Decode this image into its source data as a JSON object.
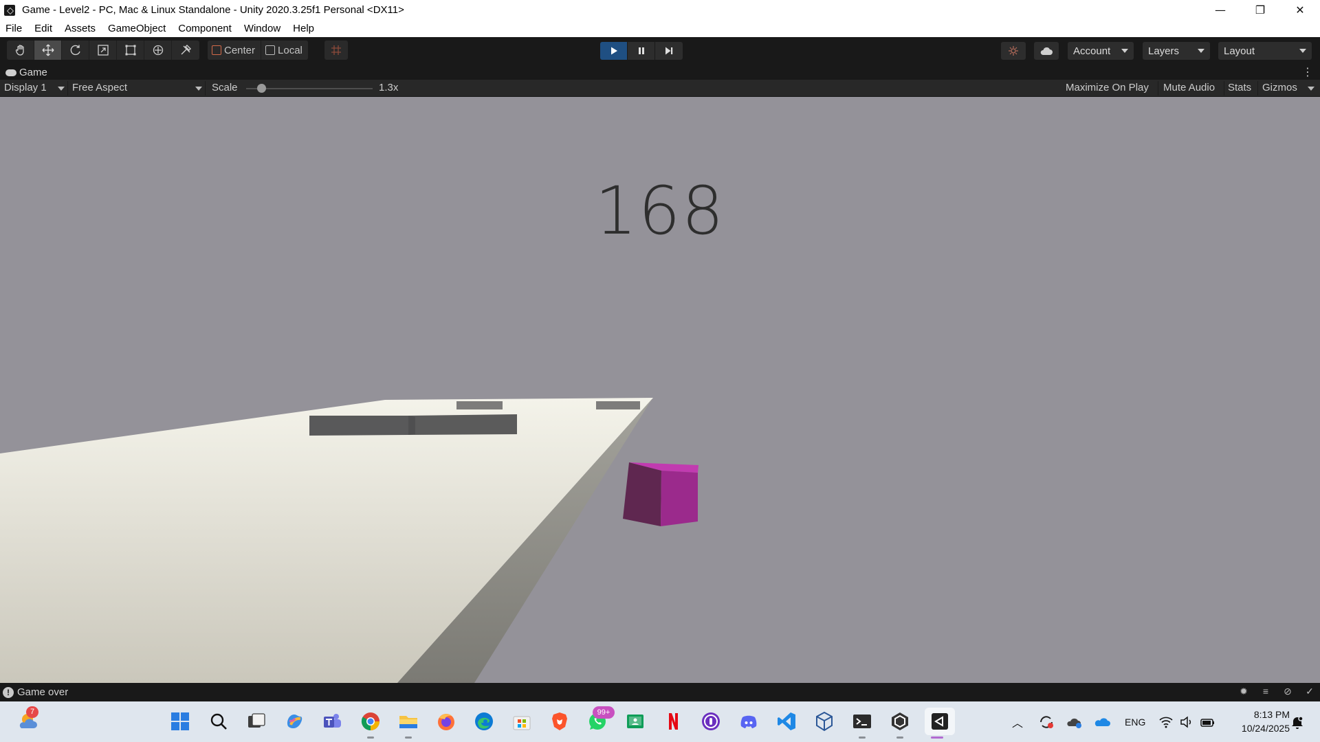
{
  "window": {
    "title": "Game - Level2 - PC, Mac & Linux Standalone - Unity 2020.3.25f1 Personal <DX11>",
    "controls": [
      "—",
      "❐",
      "✕"
    ]
  },
  "menu": [
    "File",
    "Edit",
    "Assets",
    "GameObject",
    "Component",
    "Window",
    "Help"
  ],
  "toolbar": {
    "tools": [
      "hand-tool-icon",
      "move-tool-icon",
      "rotate-tool-icon",
      "scale-tool-icon",
      "rect-tool-icon",
      "transform-tool-icon",
      "custom-tool-icon"
    ],
    "pivot_mode": "Center",
    "pivot_rotation": "Local",
    "account_label": "Account",
    "layers_label": "Layers",
    "layout_label": "Layout",
    "play_state": "playing"
  },
  "game_tab": {
    "label": "Game"
  },
  "game_view": {
    "display": "Display 1",
    "aspect": "Free Aspect",
    "scale_label": "Scale",
    "scale_value": "1.3x",
    "scale_slider_fraction": 0.12,
    "maximize_on_play": "Maximize On Play",
    "mute_audio": "Mute Audio",
    "stats": "Stats",
    "gizmos": "Gizmos"
  },
  "scene": {
    "score": "168",
    "background_color": "#949299",
    "player_color": "#9b2a8c",
    "ground_color": "#efeee4",
    "obstacle_color": "#59595a"
  },
  "status": {
    "message": "Game over"
  },
  "taskbar": {
    "weather_badge": "7",
    "whatsapp_badge": "99+",
    "language": "ENG",
    "time": "8:13 PM",
    "date": "10/24/2025",
    "apps": [
      "start-icon",
      "search-icon",
      "task-view-icon",
      "copilot-icon",
      "teams-icon",
      "chrome-icon",
      "file-explorer-icon",
      "firefox-icon",
      "edge-icon",
      "store-icon",
      "brave-icon",
      "whatsapp-icon",
      "classroom-icon",
      "netflix-icon",
      "podcast-icon",
      "discord-icon",
      "vscode-icon",
      "virtualbox-icon",
      "terminal-icon",
      "unity-hub-icon",
      "unity-editor-icon"
    ]
  }
}
